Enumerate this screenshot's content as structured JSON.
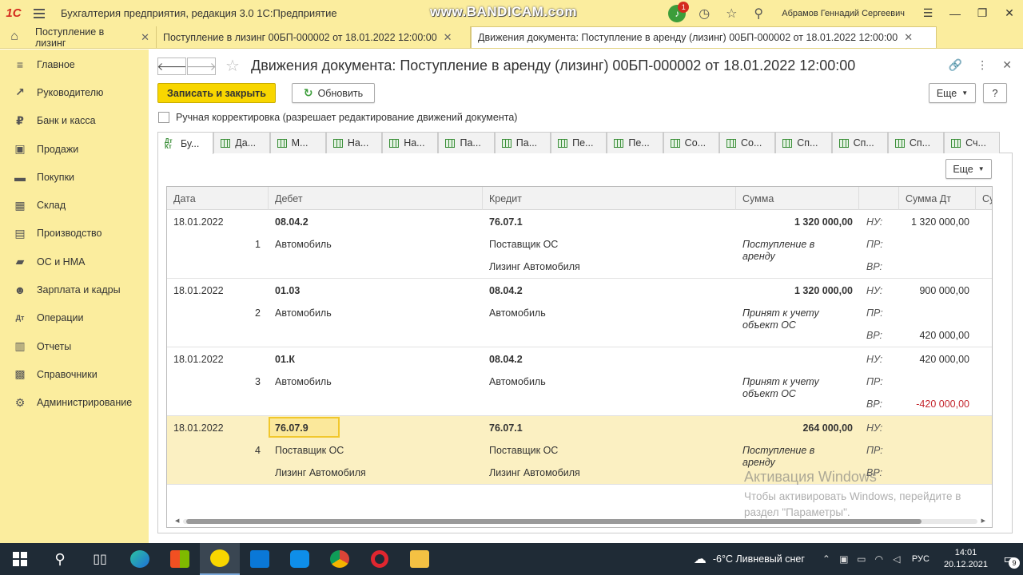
{
  "titlebar": {
    "logo": "1С",
    "app_title": "Бухгалтерия предприятия, редакция 3.0 1С:Предприятие",
    "watermark": "www.BANDICAM.com",
    "notification_count": "1",
    "user": "Абрамов Геннадий Сергеевич"
  },
  "open_tabs": [
    {
      "label": "Поступление в лизинг"
    },
    {
      "label": "Поступление в лизинг 00БП-000002 от 18.01.2022 12:00:00"
    },
    {
      "label": "Движения документа: Поступление в аренду (лизинг) 00БП-000002 от 18.01.2022 12:00:00"
    }
  ],
  "sections": [
    {
      "label": "Главное",
      "icon": "≡"
    },
    {
      "label": "Руководителю",
      "icon": "↗"
    },
    {
      "label": "Банк и касса",
      "icon": "₽"
    },
    {
      "label": "Продажи",
      "icon": "▣"
    },
    {
      "label": "Покупки",
      "icon": "▬"
    },
    {
      "label": "Склад",
      "icon": "▦"
    },
    {
      "label": "Производство",
      "icon": "▤"
    },
    {
      "label": "ОС и НМА",
      "icon": "▰"
    },
    {
      "label": "Зарплата и кадры",
      "icon": "☻"
    },
    {
      "label": "Операции",
      "icon": "Дт"
    },
    {
      "label": "Отчеты",
      "icon": "▥"
    },
    {
      "label": "Справочники",
      "icon": "▩"
    },
    {
      "label": "Администрирование",
      "icon": "⚙"
    }
  ],
  "document": {
    "title": "Движения документа: Поступление в аренду (лизинг) 00БП-000002 от 18.01.2022 12:00:00",
    "save_close": "Записать и закрыть",
    "refresh": "Обновить",
    "more": "Еще",
    "help": "?",
    "manual_correction": "Ручная корректировка (разрешает редактирование движений документа)"
  },
  "register_tabs": [
    "Бу...",
    "Да...",
    "М...",
    "На...",
    "На...",
    "Па...",
    "Па...",
    "Пе...",
    "Пе...",
    "Со...",
    "Со...",
    "Сп...",
    "Сп...",
    "Сп...",
    "Сч..."
  ],
  "table": {
    "more": "Еще",
    "headers": {
      "date": "Дата",
      "debit": "Дебет",
      "credit": "Кредит",
      "sum": "Сумма",
      "sum_dt": "Сумма Дт",
      "sum_kt": "Су"
    },
    "labels": {
      "nu": "НУ:",
      "pr": "ПР:",
      "vr": "ВР:"
    },
    "rows": [
      {
        "date": "18.01.2022",
        "num": "1",
        "debit": "08.04.2",
        "debit_sub1": "Автомобиль",
        "debit_sub2": "",
        "credit": "76.07.1",
        "credit_sub1": "Поставщик ОС",
        "credit_sub2": "Лизинг Автомобиля",
        "sum": "1 320 000,00",
        "content": "Поступление в аренду",
        "nu": "1 320 000,00",
        "pr": "",
        "vr": ""
      },
      {
        "date": "18.01.2022",
        "num": "2",
        "debit": "01.03",
        "debit_sub1": "Автомобиль",
        "debit_sub2": "",
        "credit": "08.04.2",
        "credit_sub1": "Автомобиль",
        "credit_sub2": "",
        "sum": "1 320 000,00",
        "content": "Принят к учету объект ОС",
        "nu": "900 000,00",
        "pr": "",
        "vr": "420 000,00"
      },
      {
        "date": "18.01.2022",
        "num": "3",
        "debit": "01.К",
        "debit_sub1": "Автомобиль",
        "debit_sub2": "",
        "credit": "08.04.2",
        "credit_sub1": "Автомобиль",
        "credit_sub2": "",
        "sum": "",
        "content": "Принят к учету объект ОС",
        "nu": "420 000,00",
        "pr": "",
        "vr": "-420 000,00"
      },
      {
        "date": "18.01.2022",
        "num": "4",
        "debit": "76.07.9",
        "debit_sub1": "Поставщик ОС",
        "debit_sub2": "Лизинг Автомобиля",
        "credit": "76.07.1",
        "credit_sub1": "Поставщик ОС",
        "credit_sub2": "Лизинг Автомобиля",
        "sum": "264 000,00",
        "content": "Поступление в аренду",
        "nu": "",
        "pr": "",
        "vr": ""
      }
    ]
  },
  "activation": {
    "title": "Активация Windows",
    "text": "Чтобы активировать Windows, перейдите в раздел \"Параметры\"."
  },
  "taskbar": {
    "weather": "-6°C  Ливневый снег",
    "lang": "РУС",
    "time": "14:01",
    "date": "20.12.2021",
    "notif_count": "9"
  },
  "colors": {
    "accent": "#fbed9e",
    "primary_button": "#f8d600",
    "negative": "#c4262e"
  }
}
